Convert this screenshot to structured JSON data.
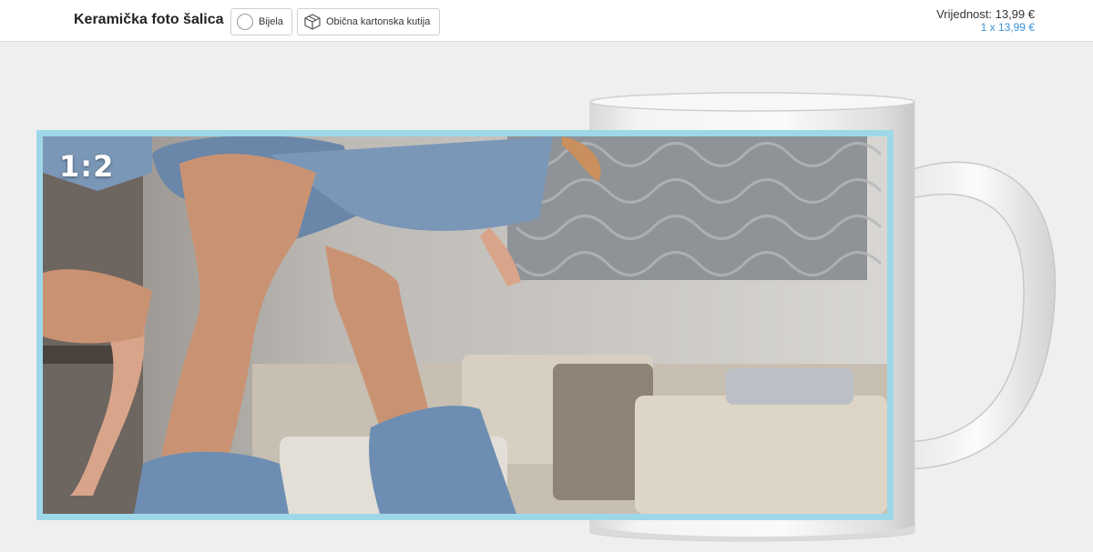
{
  "header": {
    "product_title": "Keramička foto šalica",
    "color_option": {
      "label": "Bijela",
      "swatch_color": "#ffffff",
      "icon": "color-swatch-icon"
    },
    "packaging_option": {
      "label": "Obična kartonska kutija",
      "icon": "box-icon"
    },
    "price_total": "Vrijednost: 13,99 €",
    "price_detail": "1 x 13,99 €"
  },
  "editor": {
    "aspect_ratio_label": "1:2",
    "frame_color": "#9ed8e8",
    "mug_color": "#ffffff",
    "photo_description_icon": "photo-image"
  },
  "theme": {
    "accent": "#3a93d8",
    "background": "#efefef"
  }
}
